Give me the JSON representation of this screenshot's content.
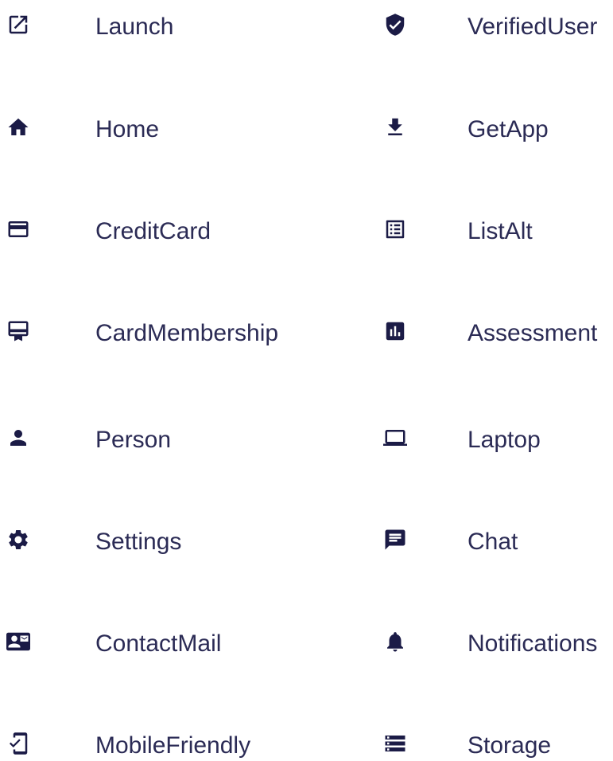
{
  "left_column": {
    "items": [
      {
        "label": "Launch",
        "icon": "launch-icon"
      },
      {
        "label": "Home",
        "icon": "home-icon"
      },
      {
        "label": "CreditCard",
        "icon": "credit-card-icon"
      },
      {
        "label": "CardMembership",
        "icon": "card-membership-icon"
      },
      {
        "label": "Person",
        "icon": "person-icon"
      },
      {
        "label": "Settings",
        "icon": "settings-icon"
      },
      {
        "label": "ContactMail",
        "icon": "contact-mail-icon"
      },
      {
        "label": "MobileFriendly",
        "icon": "mobile-friendly-icon"
      }
    ]
  },
  "right_column": {
    "items": [
      {
        "label": "VerifiedUser",
        "icon": "verified-user-icon"
      },
      {
        "label": "GetApp",
        "icon": "get-app-icon"
      },
      {
        "label": "ListAlt",
        "icon": "list-alt-icon"
      },
      {
        "label": "Assessment",
        "icon": "assessment-icon"
      },
      {
        "label": "Laptop",
        "icon": "laptop-icon"
      },
      {
        "label": "Chat",
        "icon": "chat-icon"
      },
      {
        "label": "Notifications",
        "icon": "notifications-icon"
      },
      {
        "label": "Storage",
        "icon": "storage-icon"
      }
    ]
  },
  "colors": {
    "icon": "#1b1b46",
    "text": "#2b2b55",
    "background": "#ffffff"
  }
}
